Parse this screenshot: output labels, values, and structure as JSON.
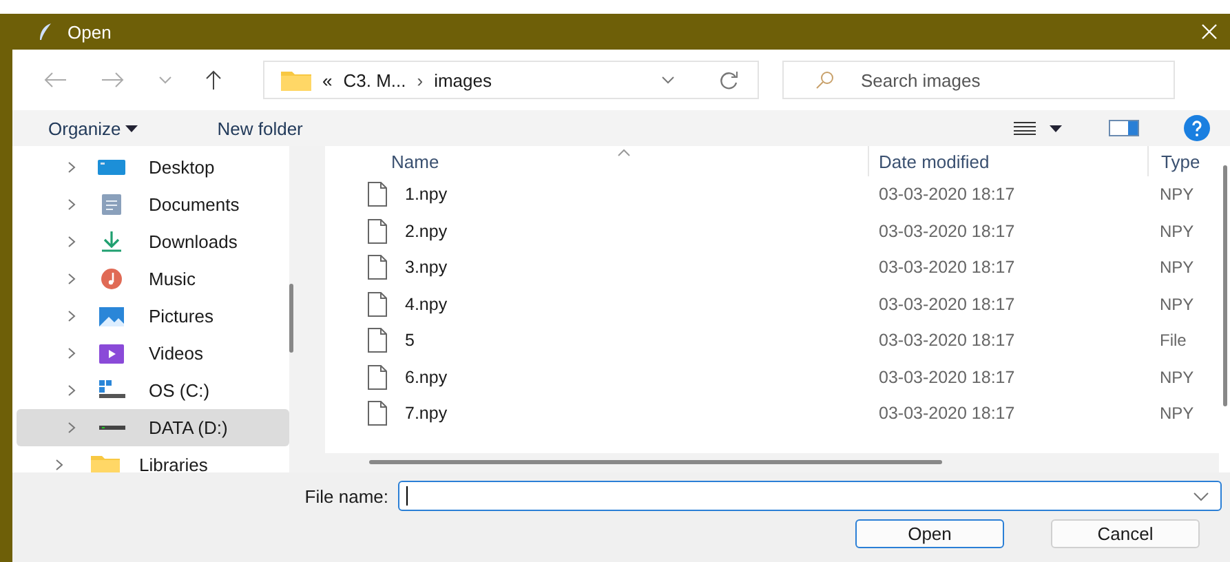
{
  "window": {
    "title": "Open"
  },
  "address": {
    "overflow": "«",
    "crumbs": [
      "C3. M...",
      "images"
    ],
    "separator": "›"
  },
  "search": {
    "placeholder": "Search images"
  },
  "commands": {
    "organize": "Organize",
    "new_folder": "New folder"
  },
  "sidebar": {
    "tree": [
      {
        "children": [
          {
            "label": "Desktop",
            "selected": false
          },
          {
            "label": "Documents",
            "selected": false
          },
          {
            "label": "Downloads",
            "selected": false
          },
          {
            "label": "Music",
            "selected": false
          },
          {
            "label": "Pictures",
            "selected": false
          },
          {
            "label": "Videos",
            "selected": false
          },
          {
            "label": "OS (C:)",
            "selected": false
          },
          {
            "label": "DATA (D:)",
            "selected": true
          }
        ]
      },
      {
        "label": "Libraries",
        "selected": false
      }
    ]
  },
  "table": {
    "columns": [
      "Name",
      "Date modified",
      "Type"
    ],
    "rows": [
      {
        "name": "1.npy",
        "date": "03-03-2020 18:17",
        "type": "NPY"
      },
      {
        "name": "2.npy",
        "date": "03-03-2020 18:17",
        "type": "NPY"
      },
      {
        "name": "3.npy",
        "date": "03-03-2020 18:17",
        "type": "NPY"
      },
      {
        "name": "4.npy",
        "date": "03-03-2020 18:17",
        "type": "NPY"
      },
      {
        "name": "5",
        "date": "03-03-2020 18:17",
        "type": "File"
      },
      {
        "name": "6.npy",
        "date": "03-03-2020 18:17",
        "type": "NPY"
      },
      {
        "name": "7.npy",
        "date": "03-03-2020 18:17",
        "type": "NPY"
      }
    ]
  },
  "file_name": {
    "label": "File name:"
  },
  "buttons": [
    {
      "label": "Open",
      "selected": true
    },
    {
      "label": "Cancel",
      "selected": false
    }
  ]
}
